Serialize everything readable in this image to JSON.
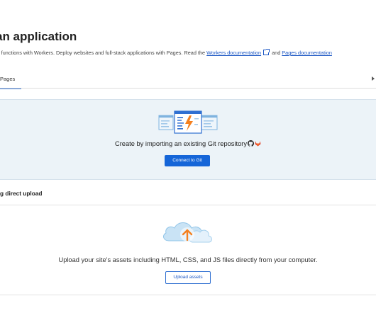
{
  "page": {
    "title": "an application",
    "description_prefix": "s functions with Workers. Deploy websites and full-stack applications with Pages. Read the",
    "workers_doc_link": "Workers documentation",
    "and_text": "and",
    "pages_doc_link": "Pages documentation"
  },
  "tabs": [
    {
      "label": "Pages",
      "active": true
    }
  ],
  "git_section": {
    "text": "Create by importing an existing Git repository",
    "button_label": "Connect to Git"
  },
  "upload_section": {
    "heading": "g direct upload",
    "text": "Upload your site's assets including HTML, CSS, and JS files directly from your computer.",
    "button_label": "Upload assets"
  },
  "colors": {
    "accent": "#1565d8",
    "panel": "#ecf3f8",
    "orange": "#f4801f"
  },
  "icons": [
    "external-link-icon",
    "github-icon",
    "gitlab-icon",
    "cloud-upload-icon",
    "code-window-illustration"
  ]
}
